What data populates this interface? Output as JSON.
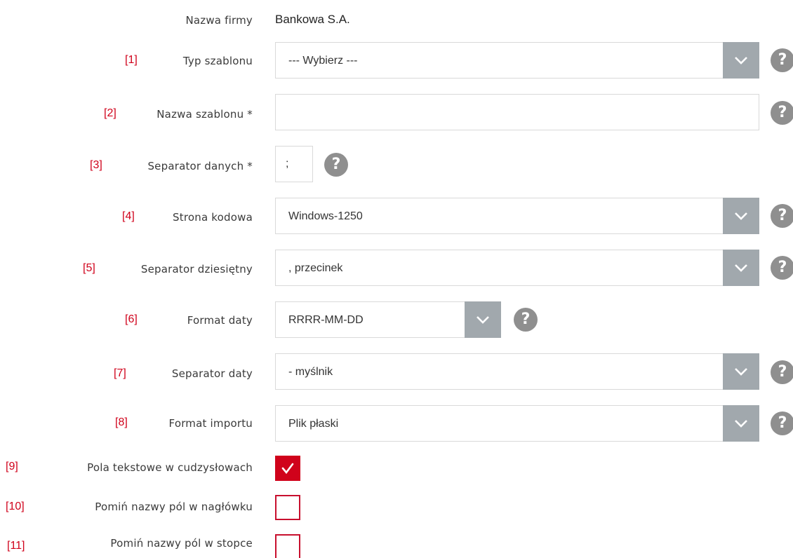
{
  "company": {
    "label": "Nazwa firmy",
    "value": "Bankowa S.A."
  },
  "fields": {
    "template_type": {
      "num": "[1]",
      "label": "Typ szablonu",
      "value": "--- Wybierz ---"
    },
    "template_name": {
      "num": "[2]",
      "label": "Nazwa szablonu *",
      "value": ""
    },
    "data_separator": {
      "num": "[3]",
      "label": "Separator danych *",
      "value": ";"
    },
    "code_page": {
      "num": "[4]",
      "label": "Strona kodowa",
      "value": "Windows-1250"
    },
    "decimal_separator": {
      "num": "[5]",
      "label": "Separator dziesiętny",
      "value": ", przecinek"
    },
    "date_format": {
      "num": "[6]",
      "label": "Format daty",
      "value": "RRRR-MM-DD"
    },
    "date_separator": {
      "num": "[7]",
      "label": "Separator daty",
      "value": "- myślnik"
    },
    "import_format": {
      "num": "[8]",
      "label": "Format importu",
      "value": "Plik płaski"
    }
  },
  "checkboxes": {
    "quoted_text": {
      "num": "[9]",
      "label": "Pola tekstowe w cudzysłowach",
      "checked": true
    },
    "skip_header": {
      "num": "[10]",
      "label": "Pomiń nazwy pól w nagłówku",
      "checked": false
    },
    "skip_footer": {
      "num": "[11]",
      "label": "Pomiń nazwy pól w stopce",
      "checked": false
    }
  },
  "help_glyph": "?",
  "icons": {
    "dropdown": "chevron-down-icon",
    "help": "question-mark-icon",
    "check": "checkmark-icon"
  },
  "colors": {
    "accent_red": "#d0021b",
    "dropdown_button": "#a1a8ad",
    "help_icon": "#8f8f8f"
  }
}
